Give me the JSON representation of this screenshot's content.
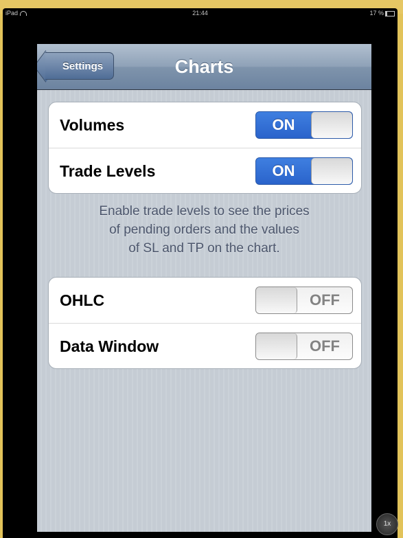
{
  "status_bar": {
    "device": "iPad",
    "time": "21:44",
    "battery": "17 %"
  },
  "nav": {
    "back_label": "Settings",
    "title": "Charts"
  },
  "groups": [
    {
      "rows": [
        {
          "label": "Volumes",
          "toggle": "ON"
        },
        {
          "label": "Trade Levels",
          "toggle": "ON"
        }
      ]
    },
    {
      "rows": [
        {
          "label": "OHLC",
          "toggle": "OFF"
        },
        {
          "label": "Data Window",
          "toggle": "OFF"
        }
      ]
    }
  ],
  "footer_note": {
    "line1": "Enable trade levels to see the prices",
    "line2": "of pending orders and the values",
    "line3": "of SL and TP on the chart."
  },
  "zoom_button": "1x",
  "colors": {
    "toggle_on": "#2a63cb",
    "navbar": "#7f94ac",
    "background": "#c5ccd4",
    "frame_border": "#e2c35a"
  }
}
